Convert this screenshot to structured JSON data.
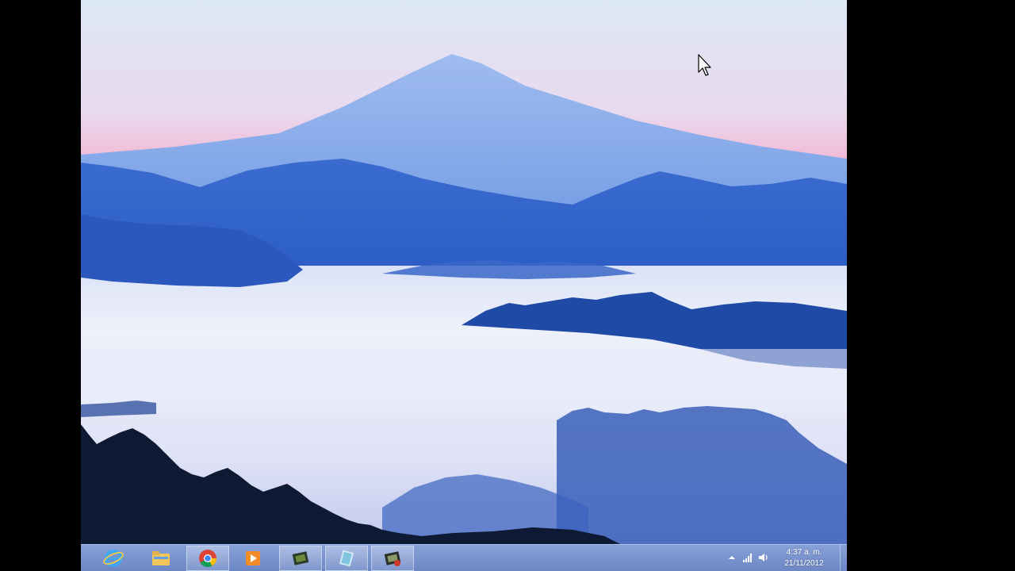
{
  "taskbar": {
    "buttons": [
      {
        "name": "internet-explorer",
        "icon": "internet-explorer-icon",
        "state": "pinned"
      },
      {
        "name": "file-explorer",
        "icon": "folder-icon",
        "state": "pinned"
      },
      {
        "name": "chrome",
        "icon": "chrome-icon",
        "state": "running"
      },
      {
        "name": "media-player",
        "icon": "media-player-icon",
        "state": "pinned"
      },
      {
        "name": "app-1",
        "icon": "app-icon",
        "state": "running"
      },
      {
        "name": "app-2",
        "icon": "app-icon",
        "state": "running"
      },
      {
        "name": "app-3",
        "icon": "app-icon",
        "state": "running"
      }
    ],
    "tray": {
      "icons": [
        "show-hidden-icons-arrow-icon",
        "network-signal-icon",
        "volume-icon"
      ]
    },
    "clock": {
      "time": "4:37 a. m.",
      "date": "21/11/2012"
    }
  },
  "colors": {
    "sky_top": "#d6e6f7",
    "sky_pink": "#f0b6d4",
    "mountain": "#6f96e3",
    "ridge": "#2f5fc4",
    "dark_ridge": "#1f4aa5",
    "fog": "#e6eaf8",
    "taskbar": "#6e8fcf"
  }
}
